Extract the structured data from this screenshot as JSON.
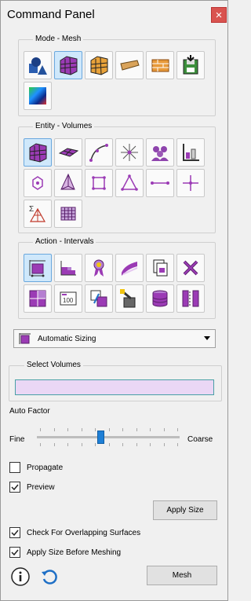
{
  "header": {
    "title": "Command Panel",
    "close_glyph": "×"
  },
  "mode_group": {
    "label": "Mode - Mesh",
    "tools": [
      {
        "icon": "geometry-icon",
        "active": false
      },
      {
        "icon": "mesh-icon",
        "active": true
      },
      {
        "icon": "boundary-conditions-icon",
        "active": false
      },
      {
        "icon": "materials-icon",
        "active": false
      },
      {
        "icon": "blocks-icon",
        "active": false
      },
      {
        "icon": "export-icon",
        "active": false
      },
      {
        "icon": "analysis-icon",
        "active": false
      }
    ]
  },
  "entity_group": {
    "label": "Entity - Volumes",
    "tools": [
      {
        "icon": "volume-icon",
        "active": true
      },
      {
        "icon": "surface-icon",
        "active": false
      },
      {
        "icon": "curve-icon",
        "active": false
      },
      {
        "icon": "vertex-icon",
        "active": false
      },
      {
        "icon": "group-icon",
        "active": false
      },
      {
        "icon": "quality-icon",
        "active": false
      },
      {
        "icon": "node-icon",
        "active": false
      },
      {
        "icon": "tet-icon",
        "active": false
      },
      {
        "icon": "quad-icon",
        "active": false
      },
      {
        "icon": "tri-icon",
        "active": false
      },
      {
        "icon": "edge-icon",
        "active": false
      },
      {
        "icon": "sphere-node-icon",
        "active": false
      },
      {
        "icon": "sum-icon",
        "active": false
      },
      {
        "icon": "grid-icon",
        "active": false
      }
    ]
  },
  "action_group": {
    "label": "Action - Intervals",
    "tools": [
      {
        "icon": "intervals-icon",
        "active": true
      },
      {
        "icon": "scheme-icon",
        "active": false
      },
      {
        "icon": "ribbon-icon",
        "active": false
      },
      {
        "icon": "smooth-icon",
        "active": false
      },
      {
        "icon": "copy-icon",
        "active": false
      },
      {
        "icon": "delete-icon",
        "active": false
      },
      {
        "icon": "refine-icon",
        "active": false
      },
      {
        "icon": "count-icon",
        "active": false
      },
      {
        "icon": "match-icon",
        "active": false
      },
      {
        "icon": "paint-icon",
        "active": false
      },
      {
        "icon": "database-icon",
        "active": false
      },
      {
        "icon": "columns-icon",
        "active": false
      }
    ]
  },
  "sizing": {
    "selected": "Automatic Sizing"
  },
  "select_volumes": {
    "label": "Select Volumes",
    "value": ""
  },
  "auto_factor": {
    "label": "Auto Factor",
    "fine": "Fine",
    "coarse": "Coarse",
    "level": 0.45
  },
  "options": {
    "propagate": {
      "label": "Propagate",
      "checked": false
    },
    "preview": {
      "label": "Preview",
      "checked": true
    },
    "check_overlap": {
      "label": "Check For Overlapping Surfaces",
      "checked": true
    },
    "apply_before": {
      "label": "Apply Size Before Meshing",
      "checked": true
    }
  },
  "buttons": {
    "apply_size": "Apply Size",
    "mesh": "Mesh"
  },
  "colors": {
    "accent": "#1e7fd6",
    "close": "#d9534f",
    "input_bg": "#ead7f5"
  }
}
